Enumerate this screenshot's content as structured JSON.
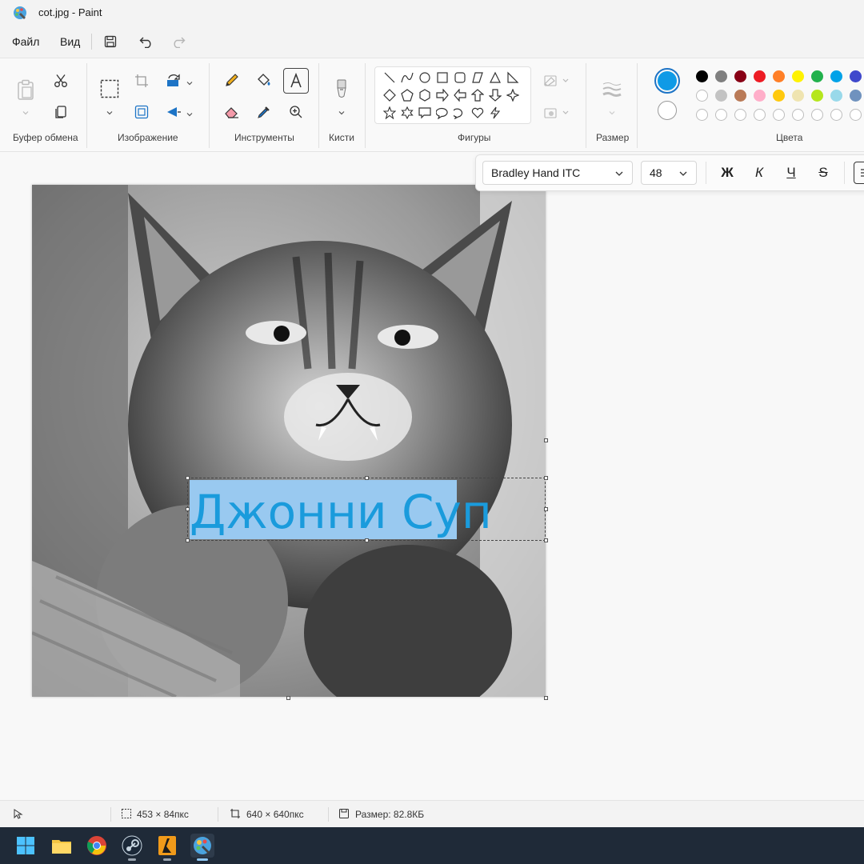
{
  "window": {
    "title": "cot.jpg - Paint"
  },
  "menu": {
    "file": "Файл",
    "view": "Вид"
  },
  "ribbon": {
    "groups": {
      "clipboard": "Буфер обмена",
      "image": "Изображение",
      "tools": "Инструменты",
      "brushes": "Кисти",
      "shapes": "Фигуры",
      "size": "Размер",
      "colors": "Цвета"
    }
  },
  "colors": {
    "primary": "#0f9ae6",
    "secondary": "#ffffff",
    "palette_row1": [
      "#000000",
      "#7f7f7f",
      "#880015",
      "#ed1c24",
      "#ff7f27",
      "#fff200",
      "#22b14c",
      "#00a2e8",
      "#3f48cc"
    ],
    "palette_row2": [
      "#ffffff",
      "#c3c3c3",
      "#b97a57",
      "#ffaec9",
      "#ffc90e",
      "#efe4b0",
      "#b5e61d",
      "#99d9ea",
      "#7092be"
    ]
  },
  "text_toolbar": {
    "font": "Bradley Hand ITC",
    "size": "48",
    "bold": "Ж",
    "italic": "К",
    "underline": "Ч",
    "strike": "S"
  },
  "canvas": {
    "text": "Джонни Суп"
  },
  "status": {
    "selection_size": "453 × 84пкс",
    "image_size": "640 × 640пкс",
    "file_size": "Размер: 82.8КБ"
  }
}
